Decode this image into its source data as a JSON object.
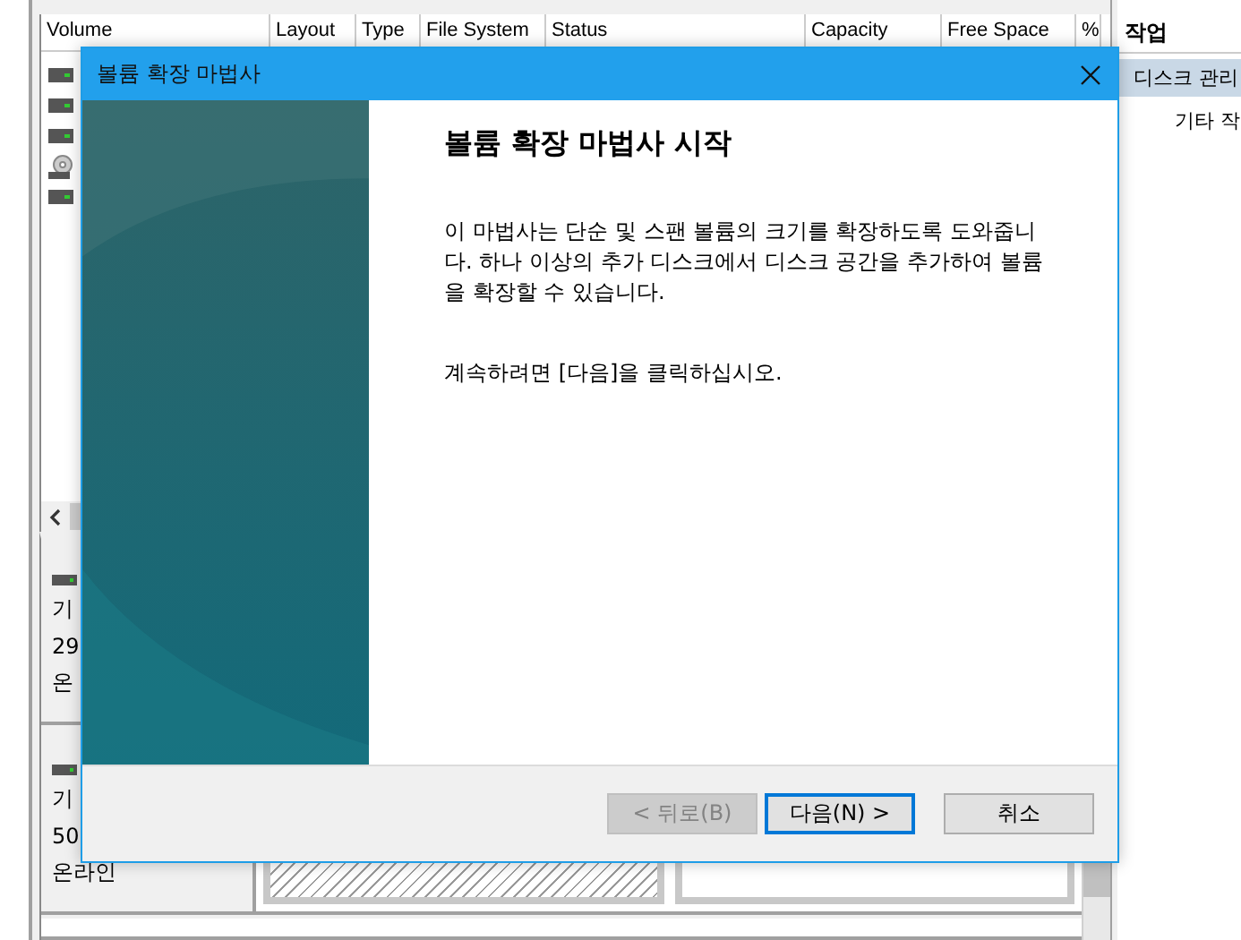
{
  "disk_management": {
    "columns": [
      "Volume",
      "Layout",
      "Type",
      "File System",
      "Status",
      "Capacity",
      "Free Space",
      "%"
    ],
    "volumes": [
      {
        "kind": "drive"
      },
      {
        "kind": "drive"
      },
      {
        "kind": "drive"
      },
      {
        "kind": "optical"
      },
      {
        "kind": "drive"
      }
    ],
    "disks": [
      {
        "lines": [
          "기",
          "29",
          "온"
        ]
      },
      {
        "lines": [
          "기",
          "50",
          "온라인"
        ]
      }
    ]
  },
  "actions": {
    "title": "작업",
    "items": [
      {
        "label": "디스크 관리",
        "selected": true
      },
      {
        "label": "기타 작",
        "selected": false
      }
    ]
  },
  "dialog": {
    "title": "볼륨 확장 마법사",
    "heading": "볼륨 확장 마법사 시작",
    "paragraphs": [
      "이 마법사는 단순 및 스팬 볼륨의 크기를 확장하도록 도와줍니다. 하나 이상의 추가 디스크에서 디스크 공간을 추가하여 볼륨을 확장할 수 있습니다.",
      "계속하려면 [다음]을 클릭하십시오."
    ],
    "buttons": [
      {
        "label": "< 뒤로(B)",
        "disabled": true,
        "default": false
      },
      {
        "label": "다음(N) >",
        "disabled": false,
        "default": true
      },
      {
        "label": "취소",
        "disabled": false,
        "default": false
      }
    ]
  }
}
